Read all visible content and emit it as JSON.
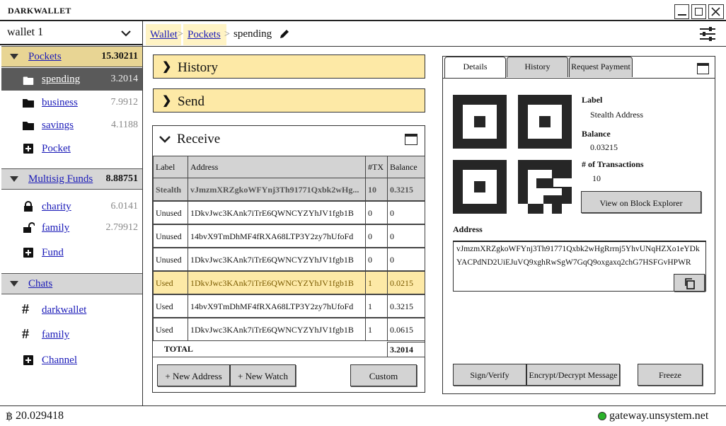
{
  "app": {
    "title": "DARKWALLET"
  },
  "sidebar": {
    "wallet_name": "wallet 1",
    "pockets": {
      "label": "Pockets",
      "total": "15.30211",
      "items": [
        {
          "label": "spending",
          "amount": "3.2014"
        },
        {
          "label": "business",
          "amount": "7.9912"
        },
        {
          "label": "savings",
          "amount": "4.1188"
        }
      ],
      "add_label": "Pocket"
    },
    "multisig": {
      "label": "Multisig Funds",
      "total": "8.88751",
      "items": [
        {
          "label": "charity",
          "amount": "6.0141"
        },
        {
          "label": "family",
          "amount": "2.79912"
        }
      ],
      "add_label": "Fund"
    },
    "chats": {
      "label": "Chats",
      "items": [
        {
          "label": "darkwallet"
        },
        {
          "label": "family"
        }
      ],
      "add_label": "Channel"
    }
  },
  "breadcrumb": {
    "wallet": "Wallet",
    "pockets": "Pockets",
    "current": "spending",
    "sep": ">"
  },
  "panels": {
    "history": "History",
    "send": "Send",
    "receive": "Receive"
  },
  "address_table": {
    "headers": [
      "Label",
      "Address",
      "#TX",
      "Balance"
    ],
    "rows": [
      {
        "label": "Stealth",
        "address": "vJmzmXRZgkoWFYnj3Th91771Qxbk2wHg...",
        "tx": "10",
        "balance": "0.3215"
      },
      {
        "label": "Unused",
        "address": "1DkvJwc3KAnk7iTrE6QWNCYZYhJV1fgb1B",
        "tx": "0",
        "balance": "0"
      },
      {
        "label": "Unused",
        "address": "14bvX9TmDhMF4fRXA68LTP3Y2zy7hUfoFd",
        "tx": "0",
        "balance": "0"
      },
      {
        "label": "Unused",
        "address": "1DkvJwc3KAnk7iTrE6QWNCYZYhJV1fgb1B",
        "tx": "0",
        "balance": "0"
      },
      {
        "label": "Used",
        "address": "1DkvJwc3KAnk7iTrE6QWNCYZYhJV1fgb1B",
        "tx": "1",
        "balance": "0.0215"
      },
      {
        "label": "Used",
        "address": "14bvX9TmDhMF4fRXA68LTP3Y2zy7hUfoFd",
        "tx": "1",
        "balance": "0.3215"
      },
      {
        "label": "Used",
        "address": "1DkvJwc3KAnk7iTrE6QWNCYZYhJV1fgb1B",
        "tx": "1",
        "balance": "0.0615"
      }
    ],
    "total_label": "TOTAL",
    "total_value": "3.2014"
  },
  "receive_buttons": {
    "new_address": "+ New Address",
    "new_watch": "+ New Watch",
    "custom": "Custom"
  },
  "details": {
    "tabs": [
      "Details",
      "History",
      "Request Payment"
    ],
    "label_key": "Label",
    "label_value": "Stealth Address",
    "balance_key": "Balance",
    "balance_value": "0.03215",
    "tx_key": "# of Transactions",
    "tx_value": "10",
    "explorer_button": "View on Block Explorer",
    "address_key": "Address",
    "address_line1": "vJmzmXRZgkoWFYnj3Th91771Qxbk2wHgRrrnj5YhvUNqHZXo1eYDk",
    "address_line2": "YACPdND2UiEJuVQ9xghRwSgW7GqQ9oxgaxq2chG7HSFGvHPWR",
    "sign_button": "Sign/Verify",
    "encrypt_button": "Encrypt/Decrypt Message",
    "freeze_button": "Freeze"
  },
  "status": {
    "balance_symbol": "฿",
    "balance": "20.029418",
    "gateway": "gateway.unsystem.net",
    "gateway_color": "#2bb32b"
  },
  "colors": {
    "accent_yellow": "#fde9a6",
    "selected_gray": "#5a5a5a"
  }
}
